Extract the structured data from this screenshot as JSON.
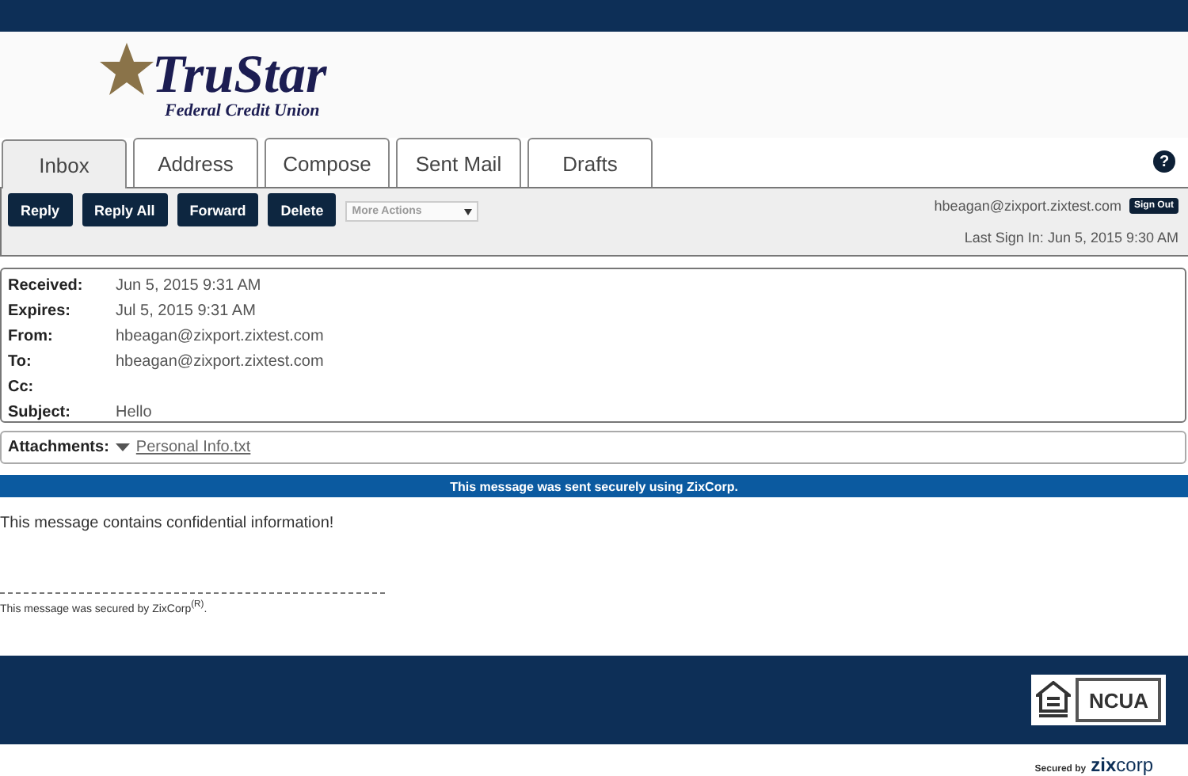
{
  "logo": {
    "name": "TruStar",
    "subtitle": "Federal Credit Union"
  },
  "tabs": [
    {
      "label": "Inbox",
      "selected": true
    },
    {
      "label": "Address",
      "selected": false
    },
    {
      "label": "Compose",
      "selected": false
    },
    {
      "label": "Sent Mail",
      "selected": false
    },
    {
      "label": "Drafts",
      "selected": false
    }
  ],
  "help": "?",
  "toolbar": {
    "buttons": [
      "Reply",
      "Reply All",
      "Forward",
      "Delete"
    ],
    "more_actions": "More Actions",
    "user": "hbeagan@zixport.zixtest.com",
    "sign_out": "Sign Out",
    "last_sign_in_label": "Last Sign In:",
    "last_sign_in": "Jun 5, 2015 9:30 AM"
  },
  "headers": [
    {
      "label": "Received:",
      "value": "Jun 5, 2015 9:31 AM"
    },
    {
      "label": "Expires:",
      "value": "Jul 5, 2015 9:31 AM"
    },
    {
      "label": "From:",
      "value": "hbeagan@zixport.zixtest.com"
    },
    {
      "label": "To:",
      "value": "hbeagan@zixport.zixtest.com"
    },
    {
      "label": "Cc:"
    },
    {
      "label": "Subject:",
      "value": "Hello"
    }
  ],
  "attachments": {
    "label": "Attachments:",
    "files": [
      "Personal Info.txt"
    ]
  },
  "banner": "This message was sent securely using ZixCorp.",
  "body": "This message contains confidential information!",
  "footer_note": "This message was secured by ZixCorp$^{(R)}$.",
  "badges": {
    "ncua": "NCUA"
  },
  "secured_by": {
    "label": "Secured by",
    "brand_a": "zix",
    "brand_b": "corp"
  }
}
